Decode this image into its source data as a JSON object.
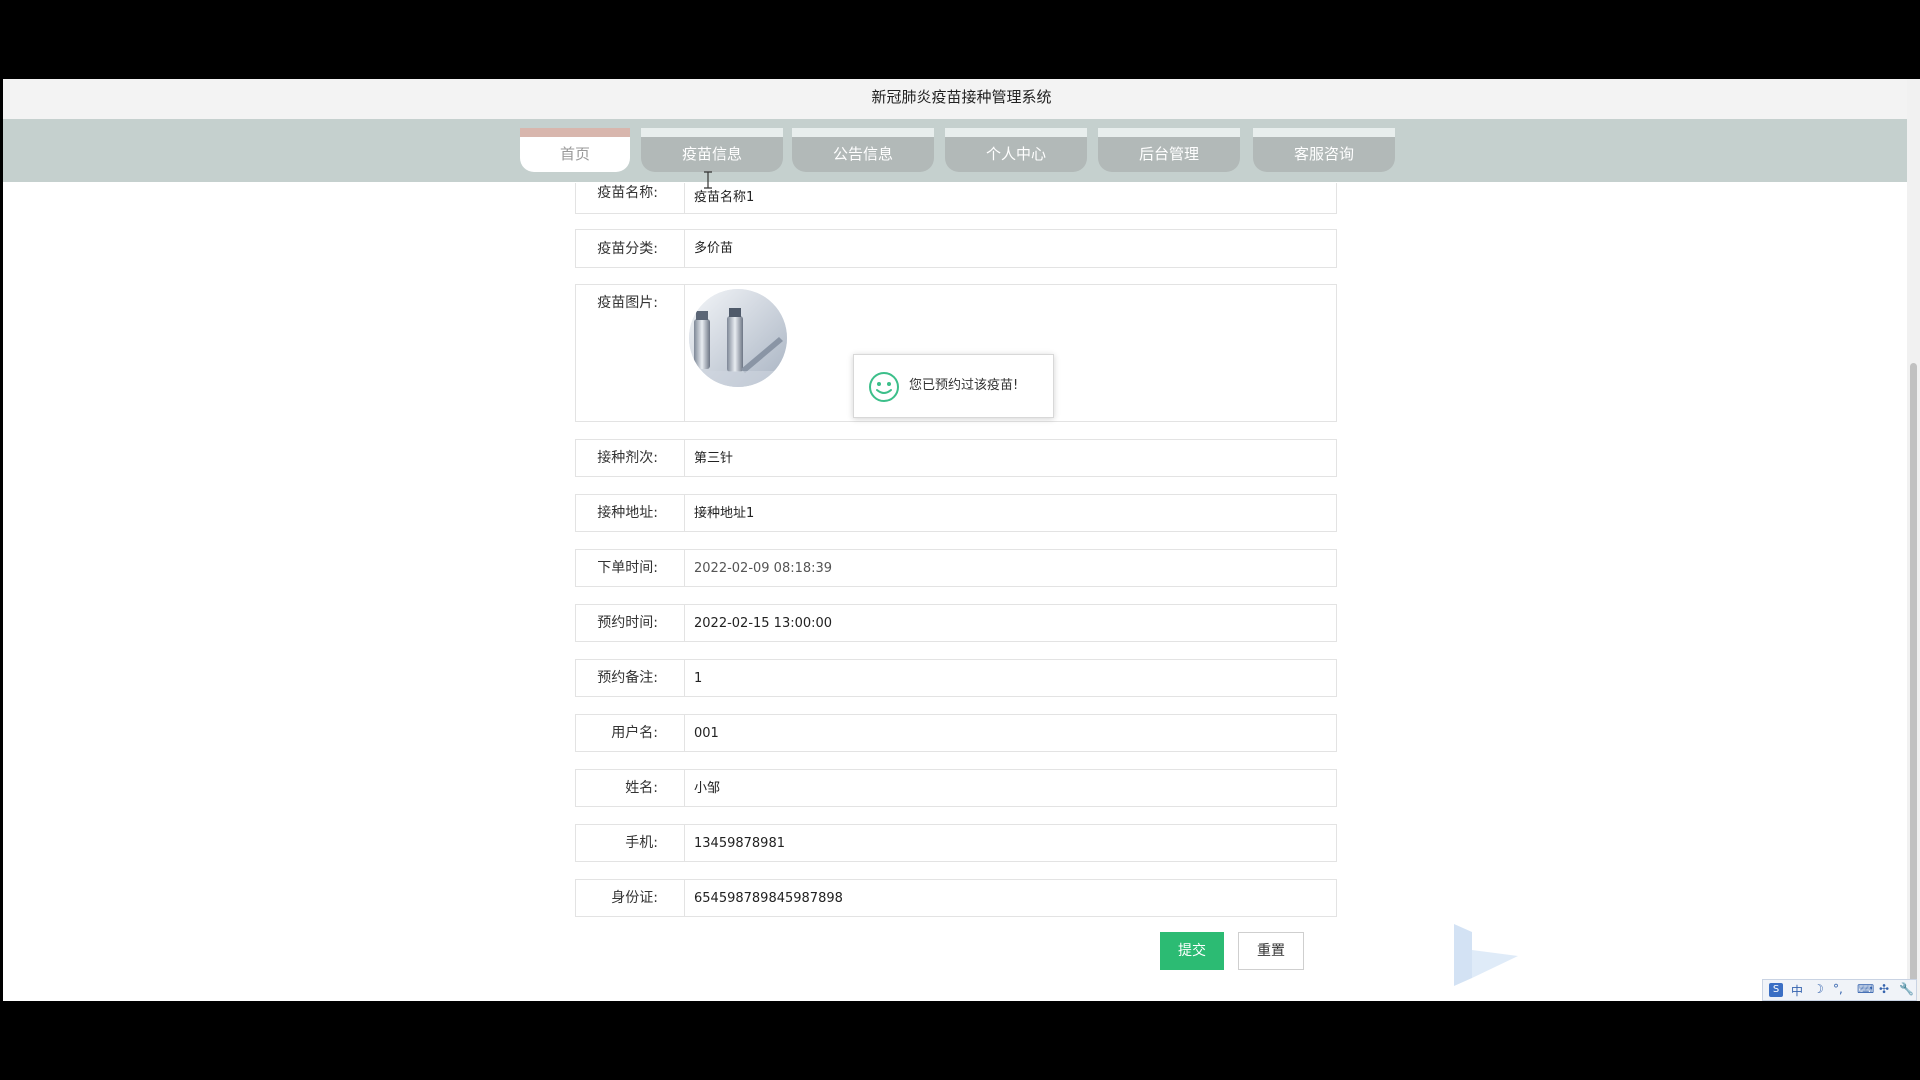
{
  "app": {
    "title": "新冠肺炎疫苗接种管理系统"
  },
  "nav": {
    "tabs": [
      {
        "label": "首页",
        "active": true
      },
      {
        "label": "疫苗信息"
      },
      {
        "label": "公告信息"
      },
      {
        "label": "个人中心"
      },
      {
        "label": "后台管理"
      },
      {
        "label": "客服咨询"
      }
    ]
  },
  "form": {
    "vaccine_name": {
      "label": "疫苗名称:",
      "value": "疫苗名称1"
    },
    "vaccine_category": {
      "label": "疫苗分类:",
      "value": "多价苗"
    },
    "vaccine_image": {
      "label": "疫苗图片:"
    },
    "dose": {
      "label": "接种剂次:",
      "value": "第三针"
    },
    "address": {
      "label": "接种地址:",
      "value": "接种地址1"
    },
    "order_time": {
      "label": "下单时间:",
      "value": "2022-02-09 08:18:39"
    },
    "appointment_time": {
      "label": "预约时间:",
      "value": "2022-02-15 13:00:00"
    },
    "remark": {
      "label": "预约备注:",
      "value": "1"
    },
    "username": {
      "label": "用户名:",
      "value": "001"
    },
    "name": {
      "label": "姓名:",
      "value": "小邹"
    },
    "phone": {
      "label": "手机:",
      "value": "13459878981"
    },
    "id_card": {
      "label": "身份证:",
      "value": "654598789845987898"
    }
  },
  "toast": {
    "message": "您已预约过该疫苗!",
    "icon": "smile-icon"
  },
  "buttons": {
    "submit": "提交",
    "reset": "重置"
  },
  "ime": {
    "mode": "中"
  },
  "colors": {
    "primary": "#2cbb73",
    "nav_bg": "#c5d0ce",
    "tab_bg": "#b2b9b8"
  }
}
